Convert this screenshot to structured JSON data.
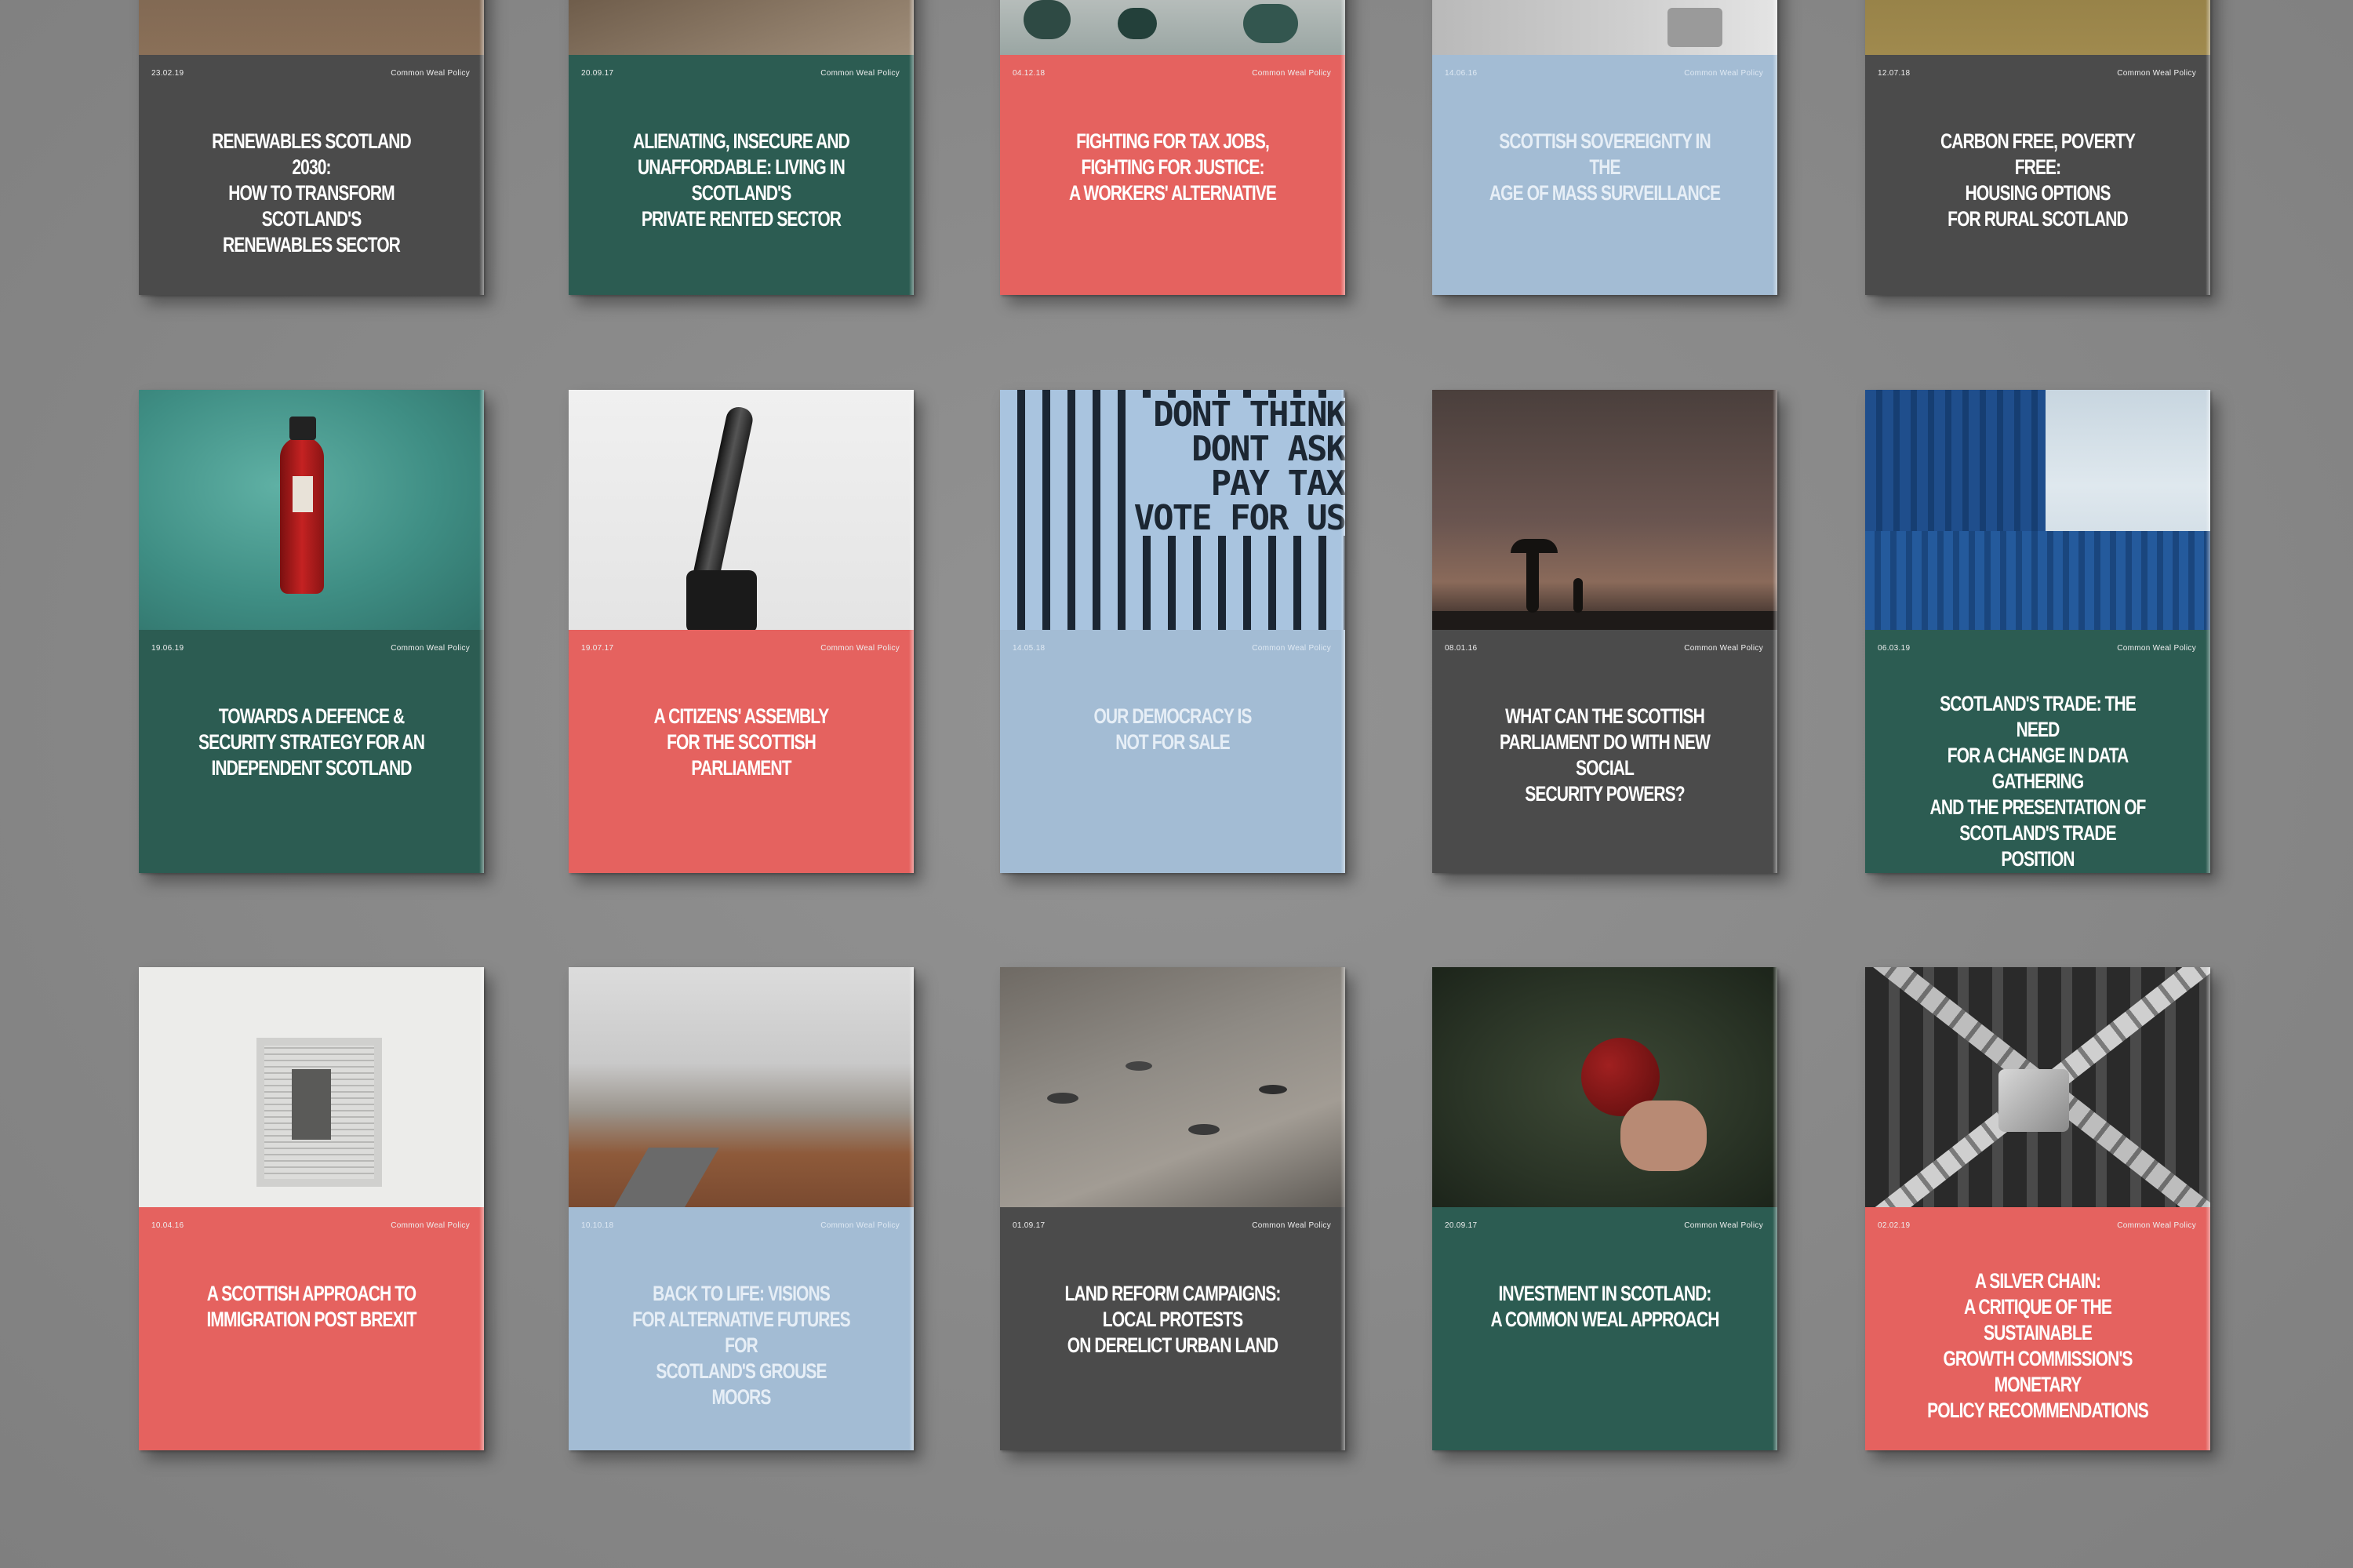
{
  "brand": "Common Weal Policy",
  "rows": [
    [
      {
        "date": "23.02.19",
        "title": "RENEWABLES SCOTLAND 2030:\nHOW TO TRANSFORM SCOTLAND'S\nRENEWABLES SECTOR",
        "color": "dark"
      },
      {
        "date": "20.09.17",
        "title": "ALIENATING, INSECURE AND\nUNAFFORDABLE: LIVING IN SCOTLAND'S\nPRIVATE RENTED SECTOR",
        "color": "green"
      },
      {
        "date": "04.12.18",
        "title": "FIGHTING FOR TAX JOBS,\nFIGHTING FOR JUSTICE:\nA WORKERS' ALTERNATIVE",
        "color": "red"
      },
      {
        "date": "14.06.16",
        "title": "SCOTTISH SOVEREIGNTY IN THE\nAGE OF MASS SURVEILLANCE",
        "color": "blue"
      },
      {
        "date": "12.07.18",
        "title": "CARBON FREE, POVERTY FREE:\nHOUSING OPTIONS\nFOR RURAL SCOTLAND",
        "color": "dark"
      }
    ],
    [
      {
        "date": "19.06.19",
        "title": "TOWARDS A DEFENCE &\nSECURITY STRATEGY FOR AN\nINDEPENDENT SCOTLAND",
        "color": "green"
      },
      {
        "date": "19.07.17",
        "title": "A CITIZENS' ASSEMBLY\nFOR THE SCOTTISH PARLIAMENT",
        "color": "red"
      },
      {
        "date": "14.05.18",
        "title": "OUR DEMOCRACY IS\nNOT FOR SALE",
        "color": "blue"
      },
      {
        "date": "08.01.16",
        "title": "WHAT CAN THE SCOTTISH\nPARLIAMENT DO WITH NEW SOCIAL\nSECURITY POWERS?",
        "color": "dark"
      },
      {
        "date": "06.03.19",
        "title": "SCOTLAND'S TRADE: THE NEED\nFOR A CHANGE IN DATA GATHERING\nAND THE PRESENTATION OF\nSCOTLAND'S TRADE POSITION",
        "color": "green"
      }
    ],
    [
      {
        "date": "10.04.16",
        "title": "A SCOTTISH APPROACH TO\nIMMIGRATION POST BREXIT",
        "color": "red"
      },
      {
        "date": "10.10.18",
        "title": "BACK TO LIFE: VISIONS\nFOR ALTERNATIVE FUTURES FOR\nSCOTLAND'S GROUSE MOORS",
        "color": "blue"
      },
      {
        "date": "01.09.17",
        "title": "LAND REFORM CAMPAIGNS:\nLOCAL PROTESTS\nON DERELICT URBAN LAND",
        "color": "dark"
      },
      {
        "date": "20.09.17",
        "title": "INVESTMENT IN SCOTLAND:\nA COMMON WEAL APPROACH",
        "color": "green"
      },
      {
        "date": "02.02.19",
        "title": "A SILVER CHAIN:\nA CRITIQUE OF THE SUSTAINABLE\nGROWTH COMMISSION'S MONETARY\nPOLICY RECOMMENDATIONS",
        "color": "red"
      }
    ]
  ],
  "poster_text": "DONT THINK\nDONT ASK\nPAY TAX\nVOTE FOR US",
  "colors": {
    "dark": "#4b4b4b",
    "green": "#2c5c52",
    "red": "#e5625f",
    "blue": "#a3bcd4",
    "background": "#8a8a8a"
  }
}
